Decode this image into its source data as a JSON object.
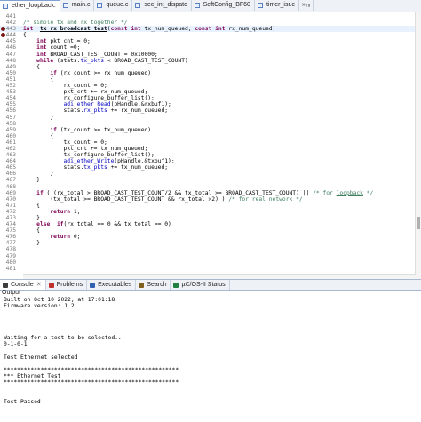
{
  "editor_tabs": [
    {
      "label": "ether_loopback.",
      "active": true,
      "dirty": true
    },
    {
      "label": "main.c",
      "active": false,
      "dirty": false
    },
    {
      "label": "queue.c",
      "active": false,
      "dirty": false
    },
    {
      "label": "sec_int_dispatc",
      "active": false,
      "dirty": false
    },
    {
      "label": "SoftConfig_BF60",
      "active": false,
      "dirty": false
    },
    {
      "label": "timer_isr.c",
      "active": false,
      "dirty": false
    }
  ],
  "more_tabs": "»₂₈",
  "code_lines": [
    {
      "n": "441",
      "bp": false,
      "segs": []
    },
    {
      "n": "442",
      "bp": false,
      "segs": [
        [
          "cm",
          "/* simple tx and rx together */"
        ]
      ]
    },
    {
      "n": "443",
      "bp": true,
      "cur": true,
      "segs": [
        [
          "kw",
          "int"
        ],
        [
          "",
          "  "
        ],
        [
          "fn ul",
          "tx_rx_broadcast_test"
        ],
        [
          "",
          "("
        ],
        [
          "kw",
          "const int"
        ],
        [
          "",
          " tx_num_queued, "
        ],
        [
          "kw",
          "const int"
        ],
        [
          "",
          " rx_num_queued)"
        ]
      ]
    },
    {
      "n": "444",
      "bp": true,
      "segs": [
        [
          "",
          "{"
        ]
      ]
    },
    {
      "n": "445",
      "bp": false,
      "segs": [
        [
          "",
          "    "
        ],
        [
          "kw",
          "int"
        ],
        [
          "",
          " pkt_cnt = 0;"
        ]
      ]
    },
    {
      "n": "446",
      "bp": false,
      "segs": [
        [
          "",
          "    "
        ],
        [
          "kw",
          "int"
        ],
        [
          "",
          " count =0;"
        ]
      ]
    },
    {
      "n": "447",
      "bp": false,
      "segs": [
        [
          "",
          "    "
        ],
        [
          "kw",
          "int"
        ],
        [
          "",
          " BROAD_CAST_TEST_COUNT = 0x10000;"
        ]
      ]
    },
    {
      "n": "448",
      "bp": false,
      "segs": [
        [
          "",
          "    "
        ],
        [
          "kw",
          "while"
        ],
        [
          "",
          " (stats."
        ],
        [
          "fld",
          "tx_pkts"
        ],
        [
          "",
          " < BROAD_CAST_TEST_COUNT)"
        ]
      ]
    },
    {
      "n": "449",
      "bp": false,
      "segs": [
        [
          "",
          "    {"
        ]
      ]
    },
    {
      "n": "450",
      "bp": false,
      "segs": [
        [
          "",
          "        "
        ],
        [
          "kw",
          "if"
        ],
        [
          "",
          " (rx_count >= rx_num_queued)"
        ]
      ]
    },
    {
      "n": "451",
      "bp": false,
      "segs": [
        [
          "",
          "        {"
        ]
      ]
    },
    {
      "n": "452",
      "bp": false,
      "segs": [
        [
          "",
          "            rx_count = 0;"
        ]
      ]
    },
    {
      "n": "453",
      "bp": false,
      "segs": [
        [
          "",
          "            pkt_cnt += rx_num_queued;"
        ]
      ]
    },
    {
      "n": "454",
      "bp": false,
      "segs": [
        [
          "",
          "            rx_configure_buffer_list();"
        ]
      ]
    },
    {
      "n": "455",
      "bp": false,
      "segs": [
        [
          "",
          "            "
        ],
        [
          "fld",
          "adi_ether_Read"
        ],
        [
          "",
          "(pHandle,&rxbuf1);"
        ]
      ]
    },
    {
      "n": "456",
      "bp": false,
      "segs": [
        [
          "",
          "            stats."
        ],
        [
          "fld",
          "rx_pkts"
        ],
        [
          "",
          " += rx_num_queued;"
        ]
      ]
    },
    {
      "n": "457",
      "bp": false,
      "segs": [
        [
          "",
          "        }"
        ]
      ]
    },
    {
      "n": "458",
      "bp": false,
      "segs": []
    },
    {
      "n": "459",
      "bp": false,
      "segs": [
        [
          "",
          "        "
        ],
        [
          "kw",
          "if"
        ],
        [
          "",
          " (tx_count >= tx_num_queued)"
        ]
      ]
    },
    {
      "n": "460",
      "bp": false,
      "segs": [
        [
          "",
          "        {"
        ]
      ]
    },
    {
      "n": "461",
      "bp": false,
      "segs": [
        [
          "",
          "            tx_count = 0;"
        ]
      ]
    },
    {
      "n": "462",
      "bp": false,
      "segs": [
        [
          "",
          "            pkt_cnt += tx_num_queued;"
        ]
      ]
    },
    {
      "n": "463",
      "bp": false,
      "segs": [
        [
          "",
          "            tx_configure_buffer_list();"
        ]
      ]
    },
    {
      "n": "464",
      "bp": false,
      "segs": [
        [
          "",
          "            "
        ],
        [
          "fld",
          "adi_ether_Write"
        ],
        [
          "",
          "(pHandle,&txbuf1);"
        ]
      ]
    },
    {
      "n": "465",
      "bp": false,
      "segs": [
        [
          "",
          "            stats."
        ],
        [
          "fld",
          "tx_pkts"
        ],
        [
          "",
          " += tx_num_queued;"
        ]
      ]
    },
    {
      "n": "466",
      "bp": false,
      "segs": [
        [
          "",
          "        }"
        ]
      ]
    },
    {
      "n": "467",
      "bp": false,
      "segs": [
        [
          "",
          "    }"
        ]
      ]
    },
    {
      "n": "468",
      "bp": false,
      "segs": []
    },
    {
      "n": "469",
      "bp": false,
      "segs": [
        [
          "",
          "    "
        ],
        [
          "kw",
          "if"
        ],
        [
          "",
          " ( (rx_total > BROAD_CAST_TEST_COUNT/2 && tx_total >= BROAD_CAST_TEST_COUNT) || "
        ],
        [
          "cm",
          "/* for "
        ],
        [
          "cm ul",
          "loopback"
        ],
        [
          "cm",
          " */"
        ]
      ]
    },
    {
      "n": "470",
      "bp": false,
      "segs": [
        [
          "",
          "        (tx_total >= BROAD_CAST_TEST_COUNT && rx_total >2) ) "
        ],
        [
          "cm",
          "/* for real network */"
        ]
      ]
    },
    {
      "n": "471",
      "bp": false,
      "segs": [
        [
          "",
          "    {"
        ]
      ]
    },
    {
      "n": "472",
      "bp": false,
      "segs": [
        [
          "",
          "        "
        ],
        [
          "kw",
          "return"
        ],
        [
          "",
          " 1;"
        ]
      ]
    },
    {
      "n": "473",
      "bp": false,
      "segs": [
        [
          "",
          "    }"
        ]
      ]
    },
    {
      "n": "474",
      "bp": false,
      "segs": [
        [
          "",
          "    "
        ],
        [
          "kw",
          "else"
        ],
        [
          "",
          "  "
        ],
        [
          "kw",
          "if"
        ],
        [
          "",
          "(rx_total == 0 && tx_total == 0)"
        ]
      ]
    },
    {
      "n": "475",
      "bp": false,
      "segs": [
        [
          "",
          "    {"
        ]
      ]
    },
    {
      "n": "476",
      "bp": false,
      "segs": [
        [
          "",
          "        "
        ],
        [
          "kw",
          "return"
        ],
        [
          "",
          " 0;"
        ]
      ]
    },
    {
      "n": "477",
      "bp": false,
      "segs": [
        [
          "",
          "    }"
        ]
      ]
    },
    {
      "n": "478",
      "bp": false,
      "segs": []
    },
    {
      "n": "479",
      "bp": false,
      "segs": []
    },
    {
      "n": "480",
      "bp": false,
      "segs": []
    },
    {
      "n": "481",
      "bp": false,
      "segs": []
    }
  ],
  "view_tabs": [
    {
      "label": "Console",
      "icon": "console-icon",
      "color": "#3c3c3c",
      "active": true,
      "close": "✕"
    },
    {
      "label": "Problems",
      "icon": "problems-icon",
      "color": "#c03030",
      "active": false,
      "close": ""
    },
    {
      "label": "Executables",
      "icon": "executables-icon",
      "color": "#3060b0",
      "active": false,
      "close": ""
    },
    {
      "label": "Search",
      "icon": "search-icon",
      "color": "#806020",
      "active": false,
      "close": ""
    },
    {
      "label": "µC/OS-II Status",
      "icon": "rtos-status-icon",
      "color": "#208040",
      "active": false,
      "close": ""
    }
  ],
  "output_label": "Output",
  "console_lines": [
    "Built on Oct 10 2022, at 17:01:18",
    "Firmware version: 1.2",
    "",
    "",
    "",
    "",
    "Waiting for a test to be selected...",
    "0-1-0-1",
    "",
    "Test Ethernet selected",
    "",
    "****************************************************",
    "*** Ethernet Test",
    "****************************************************",
    "",
    "",
    "Test Passed"
  ]
}
